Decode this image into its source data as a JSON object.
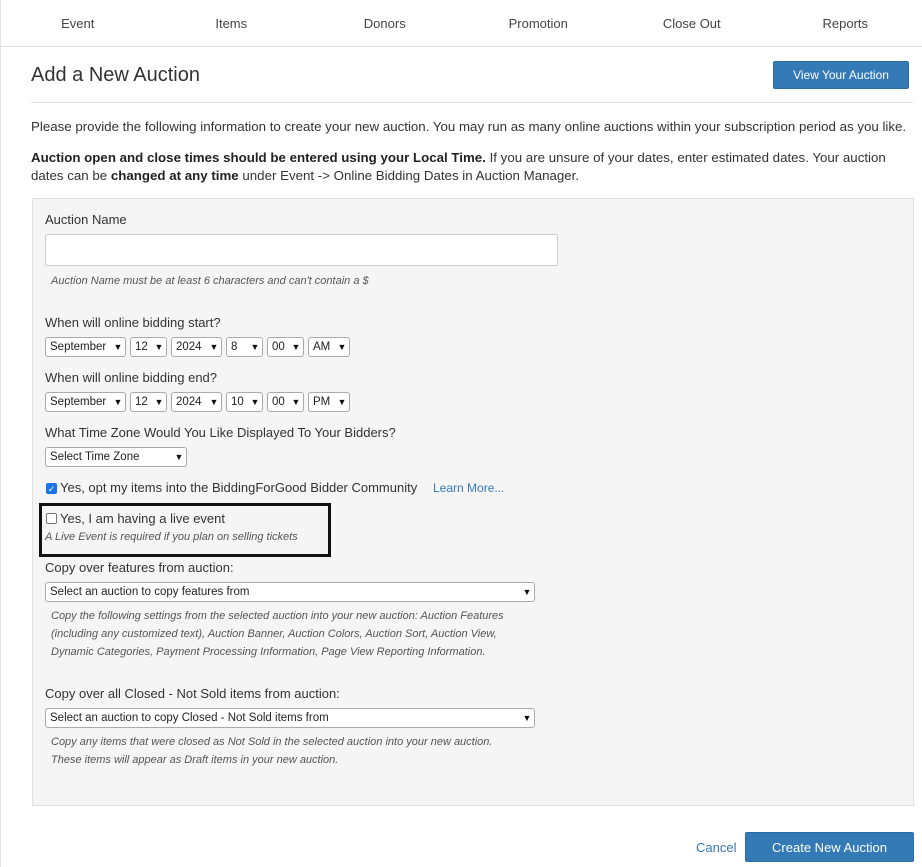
{
  "nav": {
    "items": [
      {
        "label": "Event"
      },
      {
        "label": "Items"
      },
      {
        "label": "Donors"
      },
      {
        "label": "Promotion"
      },
      {
        "label": "Close Out"
      },
      {
        "label": "Reports"
      }
    ]
  },
  "header": {
    "title": "Add a New Auction",
    "view_button": "View Your Auction"
  },
  "intro": {
    "text": "Please provide the following information to create your new auction. You may run as many online auctions within your subscription period as you like.",
    "note_bold_1": "Auction open and close times should be entered using your Local Time.",
    "note_text_1": " If you are unsure of your dates, enter estimated dates. Your auction dates can be ",
    "note_bold_2": "changed at any time",
    "note_text_2": " under Event -> Online Bidding Dates in Auction Manager."
  },
  "form": {
    "auction_name": {
      "label": "Auction Name",
      "value": "",
      "hint": "Auction Name must be at least 6 characters and can't contain a $"
    },
    "start": {
      "label": "When will online bidding start?",
      "month": "September",
      "day": "12",
      "year": "2024",
      "hour": "8",
      "minute": "00",
      "ampm": "AM"
    },
    "end": {
      "label": "When will online bidding end?",
      "month": "September",
      "day": "12",
      "year": "2024",
      "hour": "10",
      "minute": "00",
      "ampm": "PM"
    },
    "timezone": {
      "label": "What Time Zone Would You Like Displayed To Your Bidders?",
      "value": "Select Time Zone"
    },
    "community": {
      "checked": true,
      "label": "Yes, opt my items into the BiddingForGood Bidder Community",
      "link": "Learn More..."
    },
    "live_event": {
      "checked": false,
      "label": "Yes, I am having a live event",
      "hint": "A Live Event is required if you plan on selling tickets"
    },
    "copy_features": {
      "label": "Copy over features from auction:",
      "value": "Select an auction to copy features from",
      "hint_1": "Copy the following settings from the selected auction into your new auction: Auction Features",
      "hint_2": "(including any customized text), Auction Banner, Auction Colors, Auction Sort, Auction View,",
      "hint_3": "Dynamic Categories, Payment Processing Information, Page View Reporting Information."
    },
    "copy_items": {
      "label": "Copy over all Closed - Not Sold items from auction:",
      "value": "Select an auction to copy Closed - Not Sold items from",
      "hint_1": "Copy any items that were closed as Not Sold in the selected auction into your new auction.",
      "hint_2": "These items will appear as Draft items in your new auction."
    }
  },
  "actions": {
    "cancel": "Cancel",
    "create": "Create New Auction"
  },
  "colors": {
    "primary": "#337ab7",
    "panel_bg": "#f5f5f5"
  }
}
